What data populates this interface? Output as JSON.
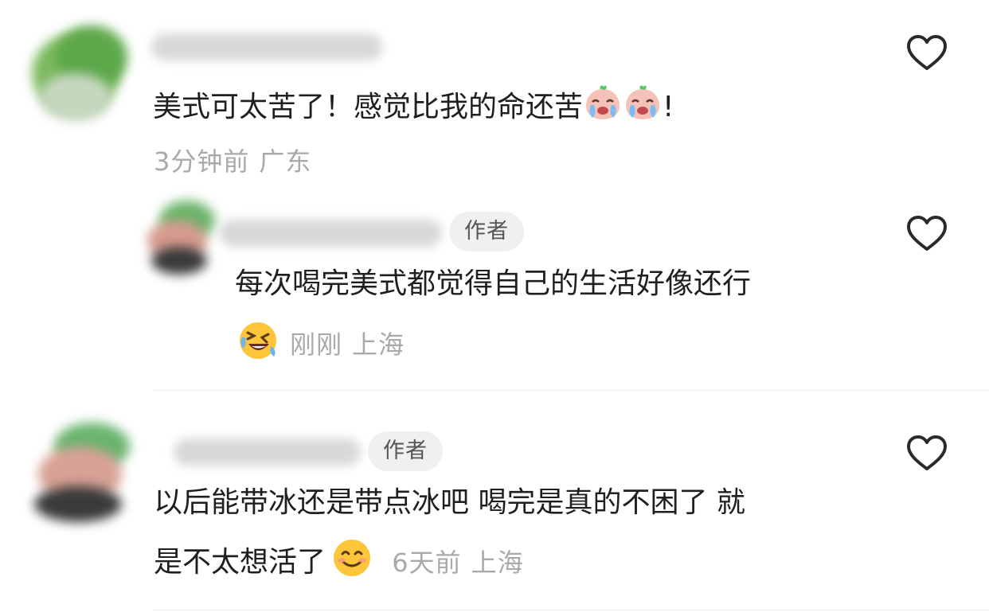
{
  "comments": [
    {
      "text": "美式可太苦了！感觉比我的命还苦",
      "text_suffix": "!",
      "inline_emojis": [
        "crying-face-icon",
        "crying-face-icon"
      ],
      "time": "3分钟前",
      "location": "广东",
      "is_author": false
    },
    {
      "badge": "作者",
      "text": "每次喝完美式都觉得自己的生活好像还行",
      "meta_emoji": "rolling-laughing-face-icon",
      "time": "刚刚",
      "location": "上海",
      "is_author": true
    },
    {
      "badge": "作者",
      "text_line1": "以后能带冰还是带点冰吧 喝完是真的不困了 就",
      "text_line2": "是不太想活了",
      "inline_emoji": "smiling-face-icon",
      "time": "6天前",
      "location": "上海",
      "is_author": true
    }
  ],
  "colors": {
    "text": "#1f1f1f",
    "meta": "#a9a9a9",
    "badge_bg": "#f0f0f0",
    "badge_text": "#555555",
    "heart_outline": "#2a2a2a"
  }
}
